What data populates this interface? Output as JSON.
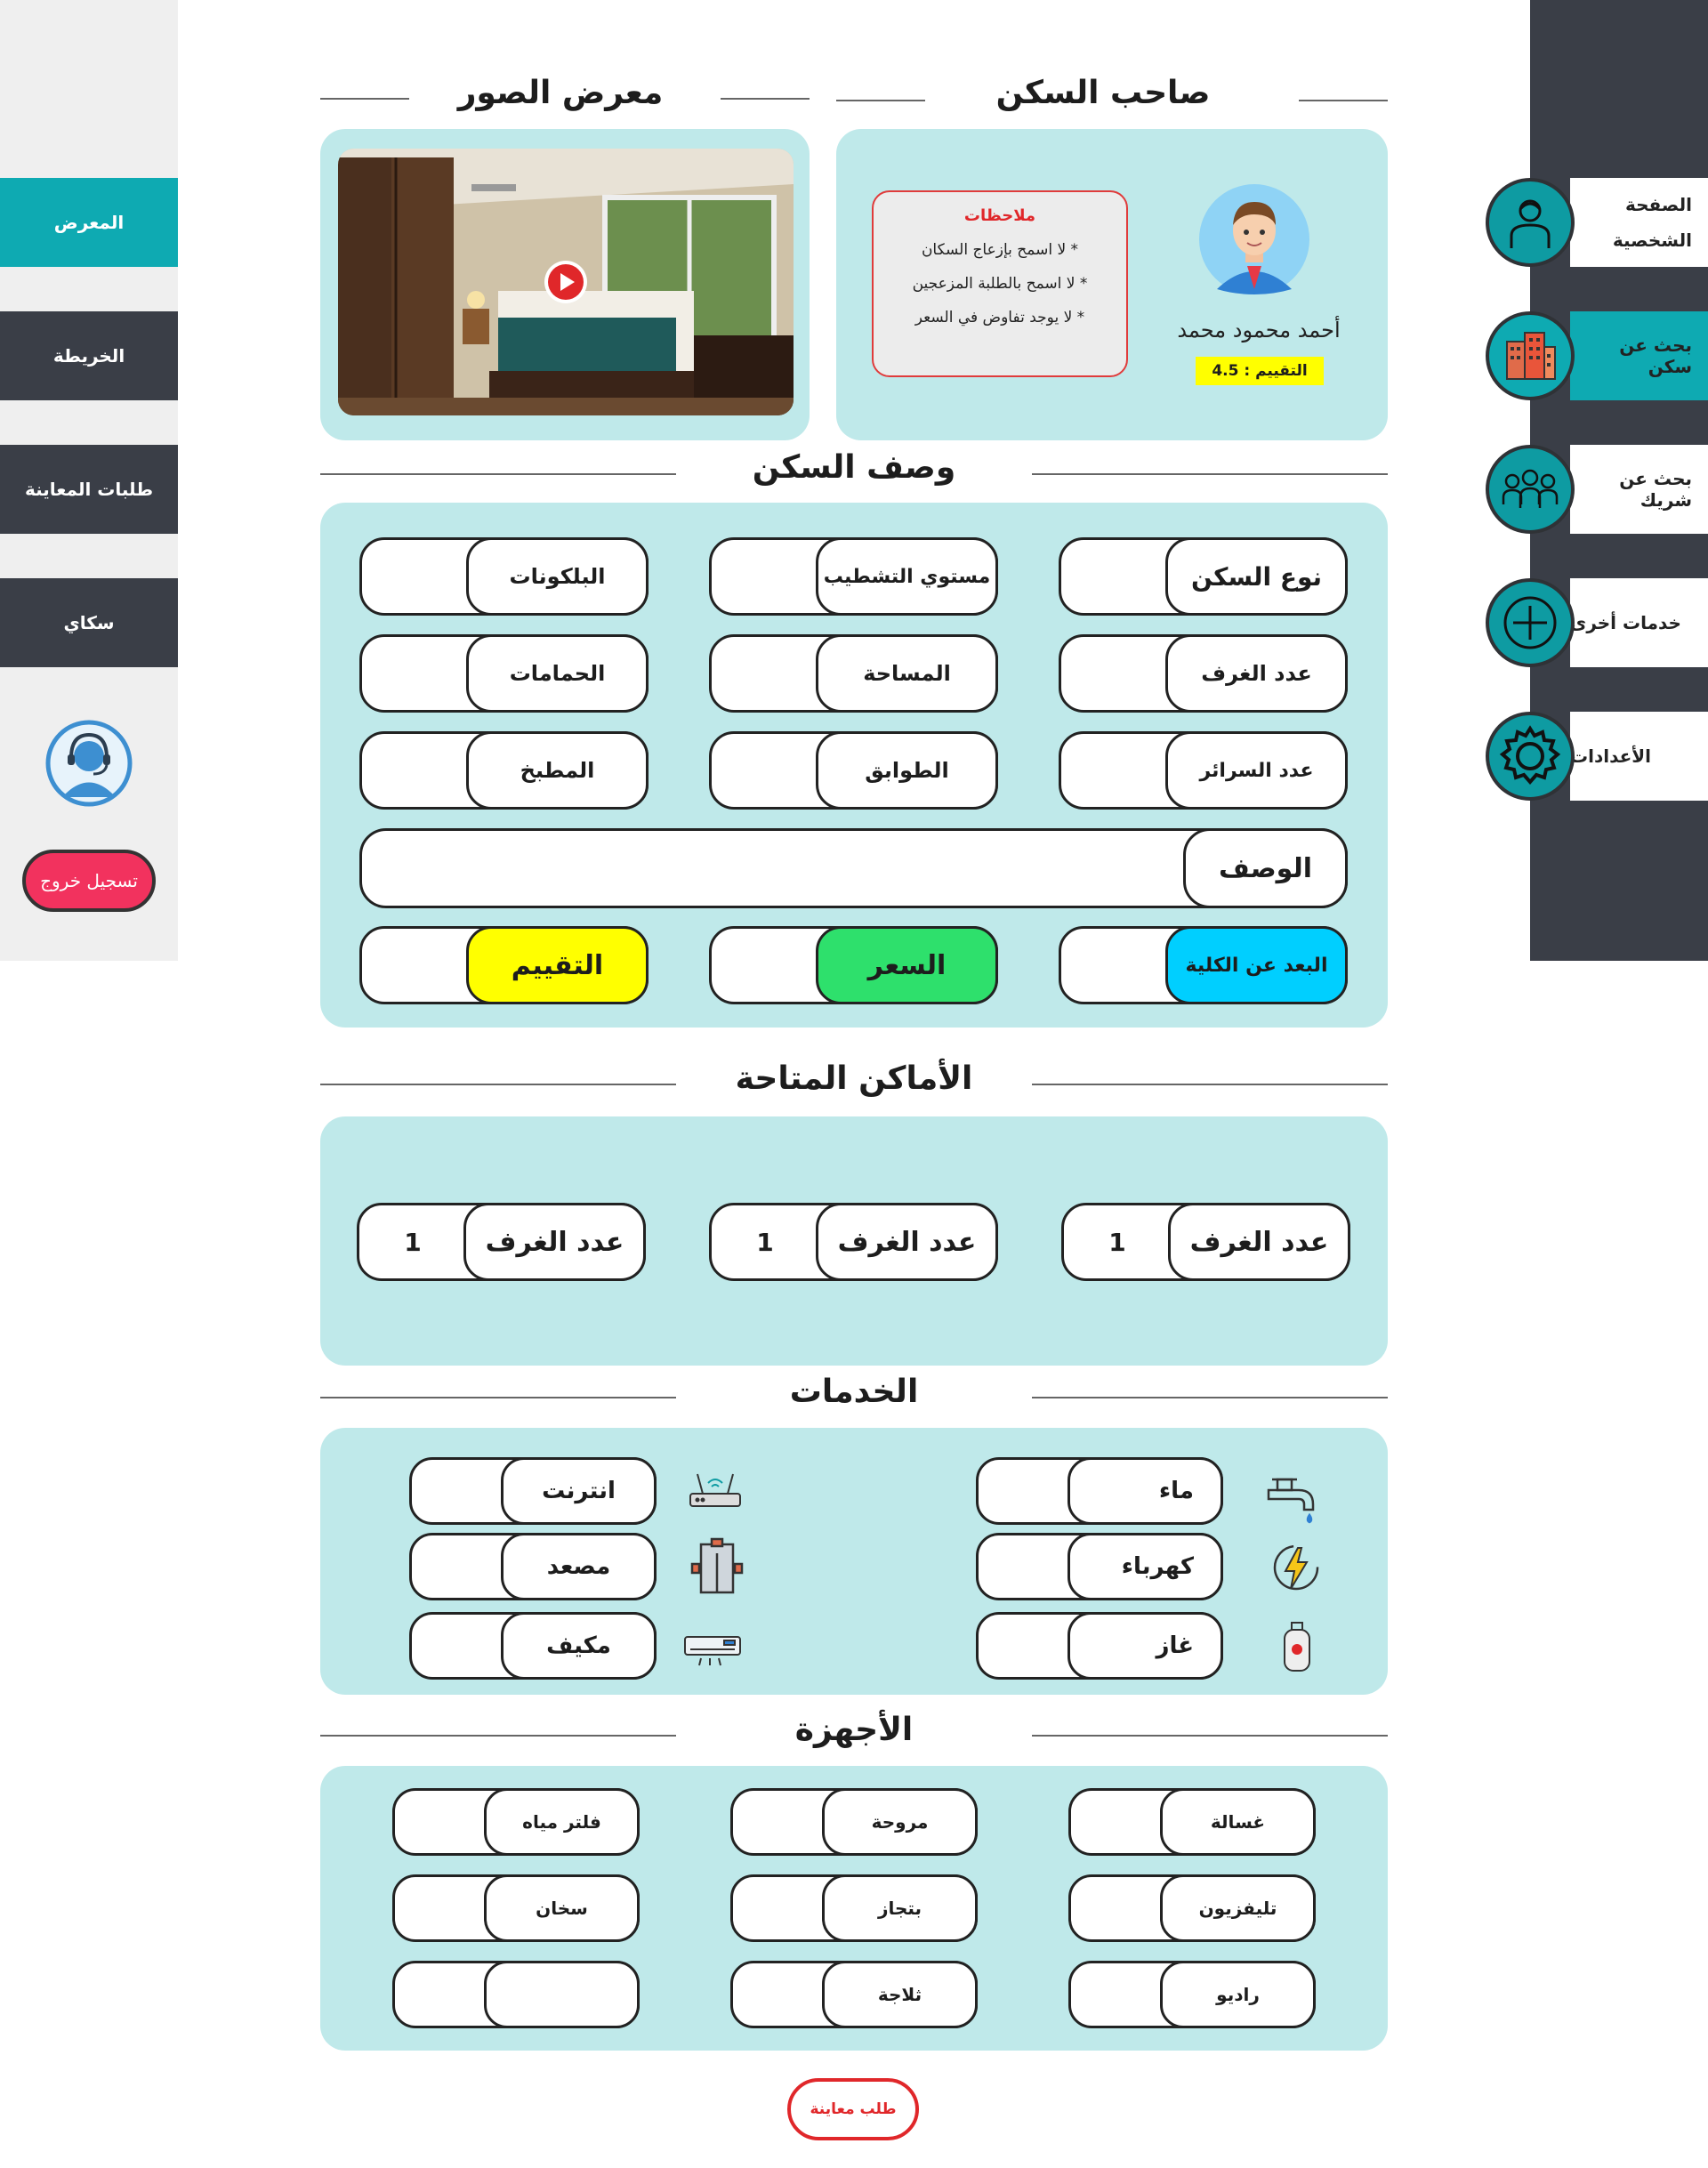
{
  "left_nav": {
    "tabs": [
      {
        "label": "المعرض",
        "active": true
      },
      {
        "label": "الخريطة",
        "active": false
      },
      {
        "label": "طلبات المعاينة",
        "active": false
      },
      {
        "label": "سكاي",
        "active": false
      }
    ],
    "support_icon": "headset-support-icon",
    "logout_label": "تسجيل خروج"
  },
  "right_nav": {
    "items": [
      {
        "label": "الصفحة الشخصية",
        "icon": "user-profile-icon",
        "active": false
      },
      {
        "label": "بحث عن سكن",
        "icon": "building-icon",
        "active": true
      },
      {
        "label": "بحث عن شريك",
        "icon": "group-people-icon",
        "active": false
      },
      {
        "label": "خدمات أخرى",
        "icon": "plus-circle-icon",
        "active": false
      },
      {
        "label": "الأعدادات",
        "icon": "gear-icon",
        "active": false
      }
    ]
  },
  "owner": {
    "heading": "صاحب السكن",
    "name": "أحمد محمود محمد",
    "rating_label": "التقييم :",
    "rating_value": "4.5",
    "notes_title": "ملاحظات",
    "notes": [
      "* لا اسمح بإزعاج السكان",
      "* لا اسمح بالطلبة المزعجين",
      "* لا يوجد تفاوض في السعر"
    ]
  },
  "gallery": {
    "heading": "معرض الصور",
    "media": "bedroom-photo-with-play-button"
  },
  "description": {
    "heading": "وصف السكن",
    "fields": {
      "type": "نوع السكن",
      "finishing": "مستوي التشطيب",
      "balconies": "البلكونات",
      "rooms": "عدد الغرف",
      "area": "المساحة",
      "bathrooms": "الحمامات",
      "beds": "عدد السرائر",
      "floors": "الطوابق",
      "kitchen": "المطبخ",
      "desc": "الوصف",
      "distance": "البعد عن الكلية",
      "price": "السعر",
      "rating": "التقييم"
    }
  },
  "places": {
    "heading": "الأماكن المتاحة",
    "items": [
      {
        "label": "عدد الغرف",
        "value": "1"
      },
      {
        "label": "عدد الغرف",
        "value": "1"
      },
      {
        "label": "عدد الغرف",
        "value": "1"
      }
    ]
  },
  "services": {
    "heading": "الخدمات",
    "items": {
      "water": "ماء",
      "internet": "انترنت",
      "electricity": "كهرباء",
      "elevator": "مصعد",
      "gas": "غاز",
      "ac": "مكيف"
    }
  },
  "appliances": {
    "heading": "الأجهزة",
    "items": {
      "washer": "غسالة",
      "fan": "مروحة",
      "water_filter": "فلتر مياه",
      "tv": "تليفزيون",
      "stove": "بتجاز",
      "heater": "سخان",
      "radio": "راديو",
      "fridge": "ثلاجة",
      "empty": ""
    }
  },
  "request_button": "طلب معاينة",
  "colors": {
    "teal": "#0e9ba2",
    "dark": "#3a3e47",
    "panel": "#bfe9ea",
    "distance": "#00cfff",
    "price": "#2ee06c",
    "rating": "#ffff00",
    "logout": "#f2325e",
    "accent_red": "#e0272a"
  }
}
